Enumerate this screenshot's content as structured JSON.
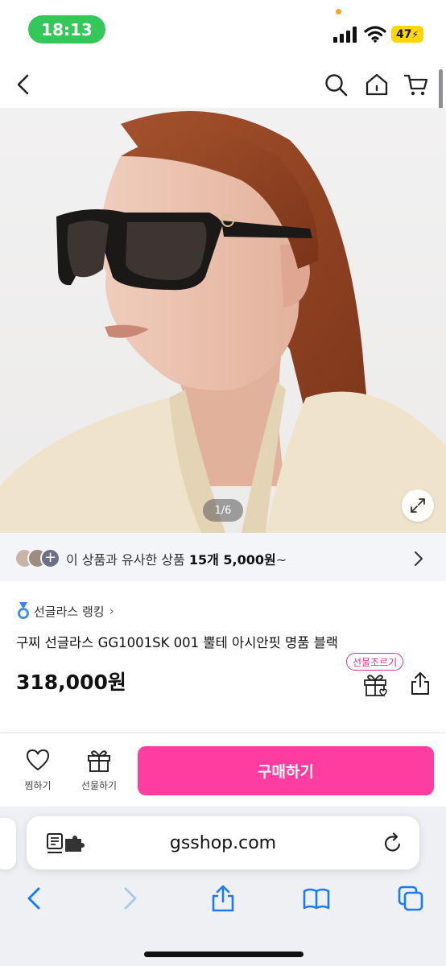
{
  "status_bar": {
    "time": "18:13",
    "battery": "47"
  },
  "hero": {
    "image_counter": "1/6"
  },
  "similar_banner": {
    "prefix": "이 상품과 유사한 상품 ",
    "count": "15개 5,000원",
    "suffix": "~"
  },
  "product": {
    "ranking_label": "선글라스 랭킹",
    "title": "구찌 선글라스 GG1001SK 001 뿔테 아시안핏 명품 블랙",
    "price": "318,000원",
    "gift_badge": "선물조르기"
  },
  "action_bar": {
    "wishlist_label": "찜하기",
    "gift_label": "선물하기",
    "buy_label": "구매하기"
  },
  "browser": {
    "url": "gsshop.com"
  },
  "colors": {
    "accent_pink": "#ff3da0",
    "status_green": "#34c759",
    "battery_yellow": "#ffd60a",
    "ios_blue": "#1a7cf5"
  }
}
